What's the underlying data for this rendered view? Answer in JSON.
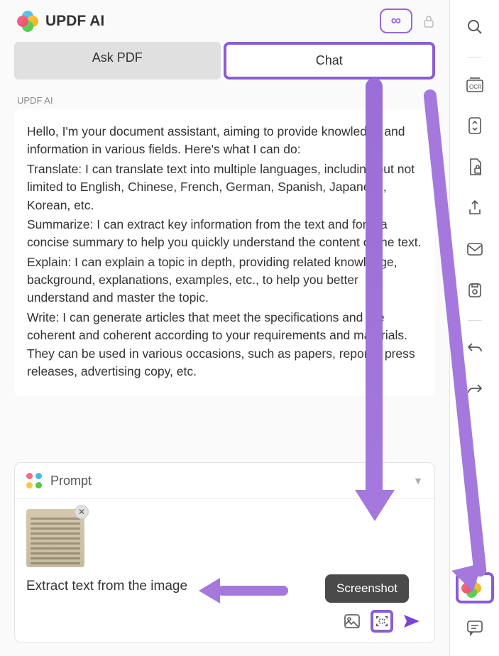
{
  "header": {
    "title": "UPDF AI",
    "infinity": "∞"
  },
  "tabs": {
    "ask": "Ask PDF",
    "chat": "Chat"
  },
  "chat_label": "UPDF AI",
  "assistant": {
    "intro": "Hello, I'm your document assistant, aiming to provide knowledge and information in various fields. Here's what I can do:",
    "translate": "Translate: I can translate text into multiple languages, including but not limited to English, Chinese, French, German, Spanish, Japanese, Korean, etc.",
    "summarize": "Summarize: I can extract key information from the text and form a concise summary to help you quickly understand the content of the text.",
    "explain": "Explain: I can explain a topic in depth, providing related knowledge, background, explanations, examples, etc., to help you better understand and master the topic.",
    "write": "Write: I can generate articles that meet the specifications and are coherent and coherent according to your requirements and materials. They can be used in various occasions, such as papers, reports, press releases, advertising copy, etc."
  },
  "prompt": {
    "title": "Prompt",
    "input_value": "Extract text from the image",
    "tooltip": "Screenshot"
  },
  "colors": {
    "accent": "#8a5cd6",
    "arrow": "#a478dc"
  }
}
